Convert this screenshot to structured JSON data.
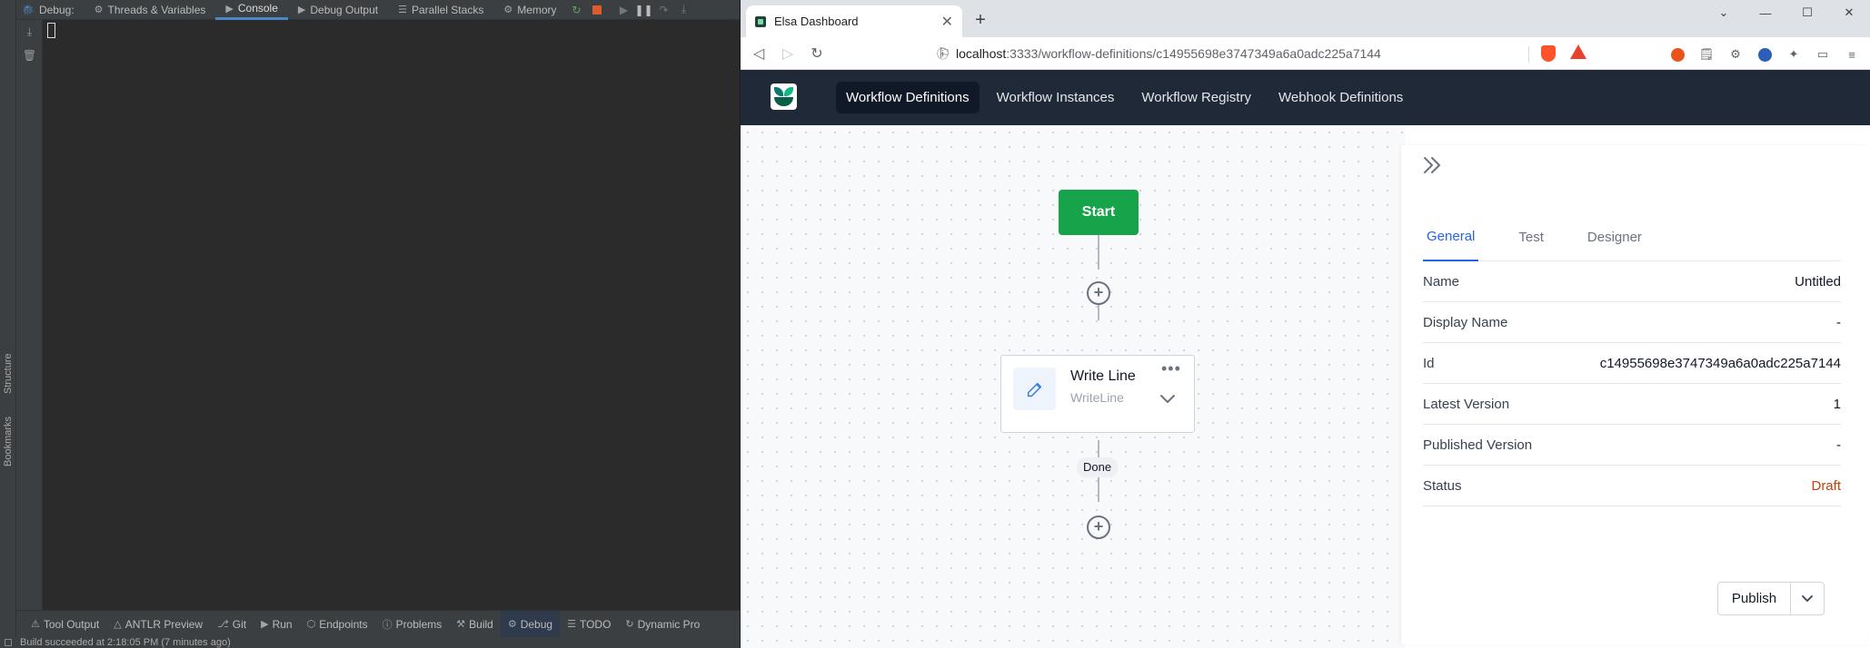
{
  "ide": {
    "tabs": [
      {
        "label": "Debug:",
        "icon": "debug-icon"
      },
      {
        "label": "Threads & Variables",
        "icon": "threads-icon"
      },
      {
        "label": "Console",
        "icon": "console-icon"
      },
      {
        "label": "Debug Output",
        "icon": "debug-output-icon"
      },
      {
        "label": "Parallel Stacks",
        "icon": "parallel-stacks-icon"
      },
      {
        "label": "Memory",
        "icon": "memory-icon"
      }
    ],
    "side_tabs": {
      "structure": "Structure",
      "bookmarks": "Bookmarks"
    },
    "tool_strip": [
      {
        "label": "Tool Output"
      },
      {
        "label": "ANTLR Preview"
      },
      {
        "label": "Git"
      },
      {
        "label": "Run"
      },
      {
        "label": "Endpoints"
      },
      {
        "label": "Problems"
      },
      {
        "label": "Build"
      },
      {
        "label": "Debug"
      },
      {
        "label": "TODO"
      },
      {
        "label": "Dynamic Pro"
      }
    ],
    "status": "Build succeeded at 2:18:05 PM  (7 minutes ago)"
  },
  "browser": {
    "tab_title": "Elsa Dashboard",
    "url_host": "localhost",
    "url_path": ":3333/workflow-definitions/c14955698e3747349a6a0adc225a7144"
  },
  "elsa": {
    "nav": [
      "Workflow Definitions",
      "Workflow Instances",
      "Workflow Registry",
      "Webhook Definitions"
    ],
    "designer": {
      "start_label": "Start",
      "activity_title": "Write Line",
      "activity_type": "WriteLine",
      "outcome_label": "Done"
    },
    "panel": {
      "tabs": [
        "General",
        "Test",
        "Designer"
      ],
      "props": [
        {
          "label": "Name",
          "value": "Untitled"
        },
        {
          "label": "Display Name",
          "value": "-"
        },
        {
          "label": "Id",
          "value": "c14955698e3747349a6a0adc225a7144"
        },
        {
          "label": "Latest Version",
          "value": "1"
        },
        {
          "label": "Published Version",
          "value": "-"
        },
        {
          "label": "Status",
          "value": "Draft"
        }
      ],
      "publish_label": "Publish"
    }
  },
  "colors": {
    "ide_bg": "#2b2b2b",
    "nav_bg": "#1f2937",
    "start_green": "#16a34a",
    "tab_active_blue": "#2563eb",
    "draft_orange": "#c2410c"
  }
}
